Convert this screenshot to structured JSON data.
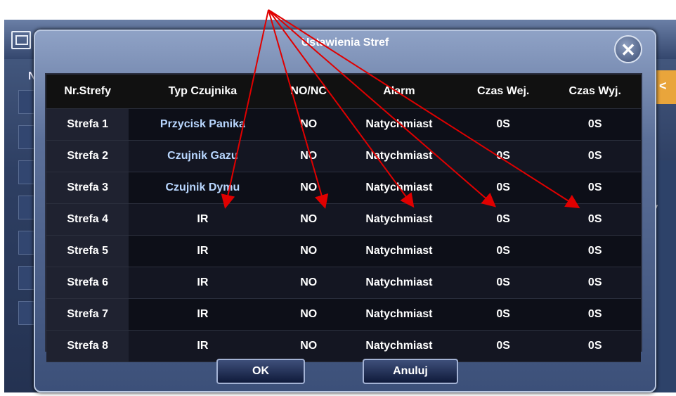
{
  "dialog": {
    "title": "Ustawienia Stref",
    "close_glyph": "✕",
    "ok_label": "OK",
    "cancel_label": "Anuluj"
  },
  "background": {
    "left_letter": "N",
    "orange_glyph": "<",
    "right_glyph": "v"
  },
  "table": {
    "headers": [
      "Nr.Strefy",
      "Typ Czujnika",
      "NO/NC",
      "Alarm",
      "Czas Wej.",
      "Czas Wyj."
    ],
    "rows": [
      [
        "Strefa 1",
        "Przycisk Panika",
        "NO",
        "Natychmiast",
        "0S",
        "0S"
      ],
      [
        "Strefa 2",
        "Czujnik Gazu",
        "NO",
        "Natychmiast",
        "0S",
        "0S"
      ],
      [
        "Strefa 3",
        "Czujnik Dymu",
        "NO",
        "Natychmiast",
        "0S",
        "0S"
      ],
      [
        "Strefa 4",
        "IR",
        "NO",
        "Natychmiast",
        "0S",
        "0S"
      ],
      [
        "Strefa 5",
        "IR",
        "NO",
        "Natychmiast",
        "0S",
        "0S"
      ],
      [
        "Strefa 6",
        "IR",
        "NO",
        "Natychmiast",
        "0S",
        "0S"
      ],
      [
        "Strefa 7",
        "IR",
        "NO",
        "Natychmiast",
        "0S",
        "0S"
      ],
      [
        "Strefa 8",
        "IR",
        "NO",
        "Natychmiast",
        "0S",
        "0S"
      ]
    ]
  },
  "colors": {
    "annotation_arrow": "#e00000",
    "dialog_accent": "#5c7099",
    "orange_tab": "#e9a53b"
  }
}
